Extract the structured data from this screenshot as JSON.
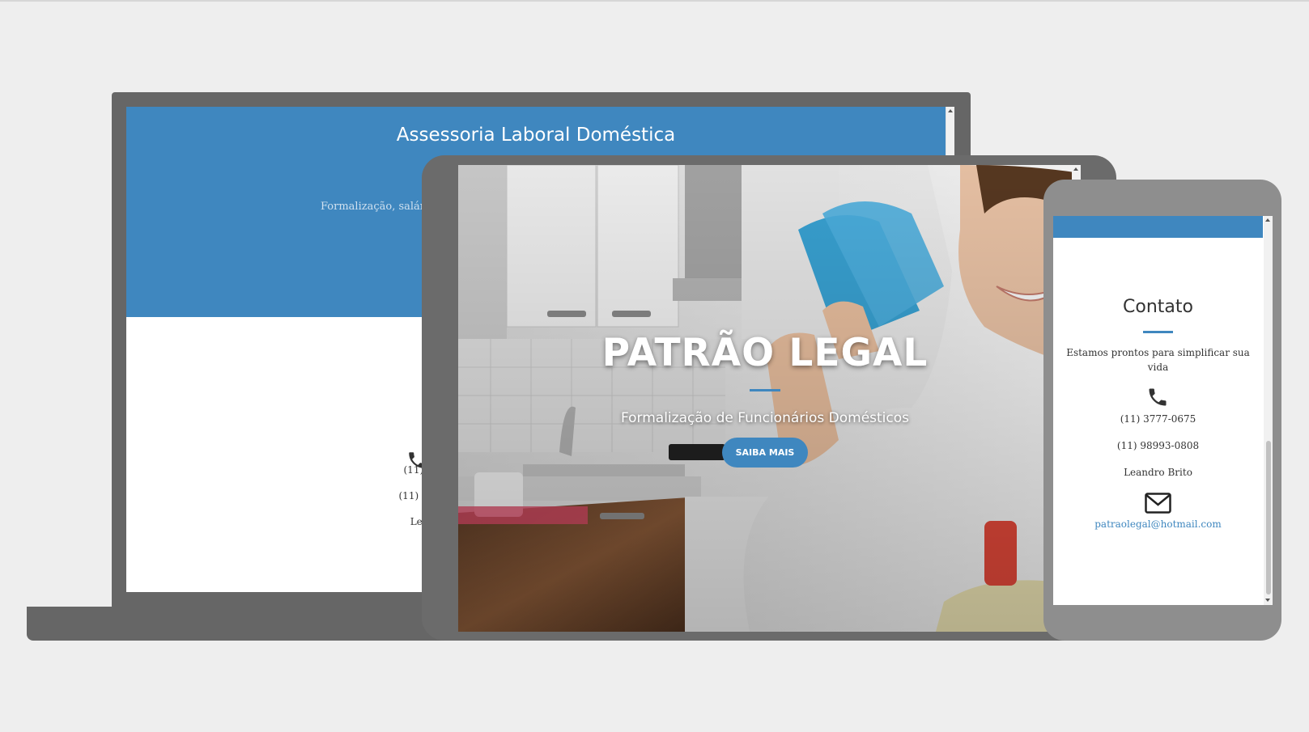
{
  "laptop": {
    "title": "Assessoria Laboral Doméstica",
    "subtitle_partial": "Formalização, salário",
    "phone1_partial": "(11) 3777",
    "phone2_partial": "(11) 9899",
    "name_partial": "Leandro"
  },
  "tablet": {
    "hero_title": "PATRÃO LEGAL",
    "hero_subtitle": "Formalização de Funcionários Domésticos",
    "cta_label": "SAIBA MAIS"
  },
  "phone": {
    "contact_title": "Contato",
    "contact_text": "Estamos prontos para simplificar sua vida",
    "phone1": "(11) 3777-0675",
    "phone2": "(11) 98993-0808",
    "contact_name": "Leandro Brito",
    "email": "patraolegal@hotmail.com"
  },
  "colors": {
    "accent": "#3f87bf",
    "device_frame": "#666666",
    "background": "#eeeeee"
  },
  "icons": [
    "phone-icon",
    "envelope-icon",
    "scroll-up-arrow-icon",
    "scroll-down-arrow-icon"
  ]
}
